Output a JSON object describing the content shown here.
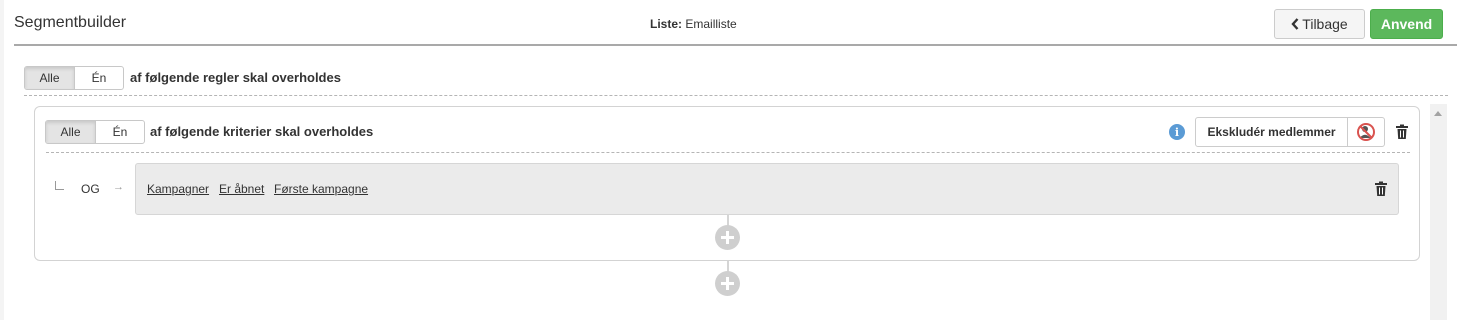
{
  "header": {
    "title": "Segmentbuilder",
    "list_label": "Liste:",
    "list_name": "Emailliste",
    "back_label": "Tilbage",
    "apply_label": "Anvend"
  },
  "rules": {
    "toggle_all": "Alle",
    "toggle_one": "Én",
    "text": "af følgende regler skal overholdes"
  },
  "group": {
    "toggle_all": "Alle",
    "toggle_one": "Én",
    "text": "af følgende kriterier skal overholdes",
    "exclude_label": "Ekskludér medlemmer",
    "condition": {
      "operator": "OG",
      "links": [
        "Kampagner",
        "Er åbnet",
        "Første kampagne"
      ]
    }
  },
  "colors": {
    "apply_green": "#5cb85c",
    "info_blue": "#5b9bd5",
    "exclude_red": "#d9534f"
  }
}
